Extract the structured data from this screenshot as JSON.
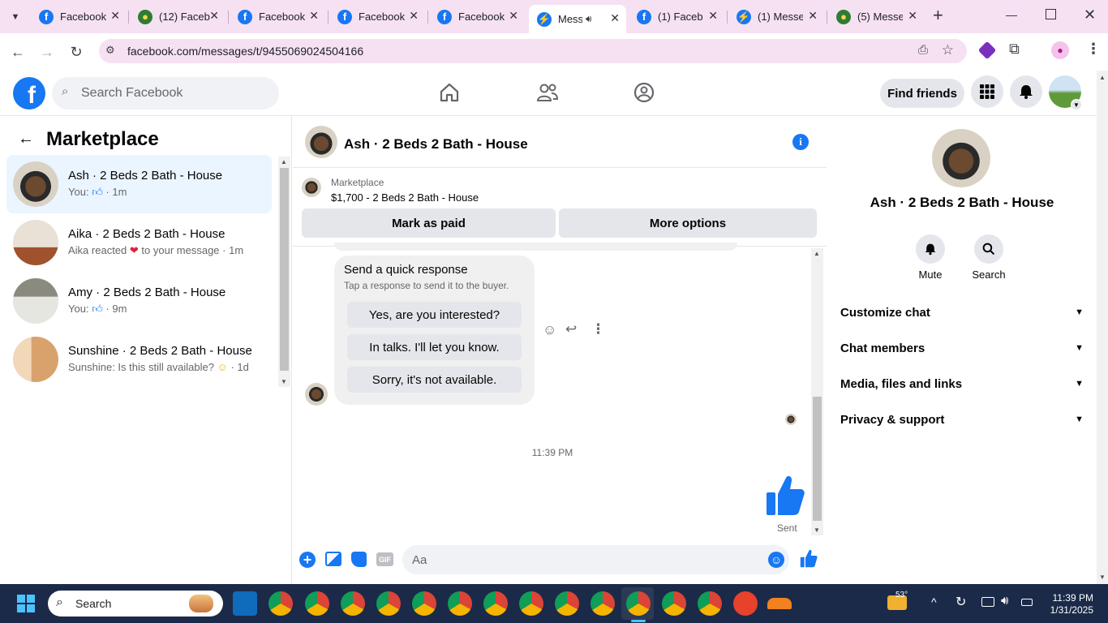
{
  "browser": {
    "tabs": [
      {
        "title": "Facebook",
        "icon": "facebook-icon"
      },
      {
        "title": "(12) Faceb",
        "icon": "globe-icon"
      },
      {
        "title": "Facebook",
        "icon": "facebook-icon"
      },
      {
        "title": "Facebook",
        "icon": "facebook-icon"
      },
      {
        "title": "Facebook",
        "icon": "facebook-icon"
      },
      {
        "title": "Messe",
        "icon": "messenger-icon",
        "active": true,
        "audio": true
      },
      {
        "title": "(1) Facebo",
        "icon": "facebook-icon"
      },
      {
        "title": "(1) Messe",
        "icon": "messenger-icon"
      },
      {
        "title": "(5) Messe",
        "icon": "globe-icon"
      }
    ],
    "new_tab_label": "+",
    "url": "facebook.com/messages/t/9455069024504166",
    "tab_bg_color": "#f6e1f3"
  },
  "facebook": {
    "logo_letter": "f",
    "search_placeholder": "Search Facebook",
    "find_friends_label": "Find friends",
    "brand_color": "#1877f2"
  },
  "left": {
    "title": "Marketplace",
    "conversations": [
      {
        "name": "Ash · 2 Beds 2 Bath - House",
        "prefix": "You:",
        "icon": "thumbs-up-icon",
        "time": "· 1m"
      },
      {
        "name": "Aika · 2 Beds 2 Bath - House",
        "prefix": "Aika reacted",
        "icon": "heart-icon",
        "suffix": "to your message",
        "time": "· 1m"
      },
      {
        "name": "Amy · 2 Beds 2 Bath - House",
        "prefix": "You:",
        "icon": "thumbs-up-icon",
        "time": "· 9m"
      },
      {
        "name": "Sunshine · 2 Beds 2 Bath - House",
        "prefix": "Sunshine: Is this still available?",
        "icon": "smile-emoji-icon",
        "time": "· 1d"
      }
    ]
  },
  "chat": {
    "header_name": "Ash · 2 Beds 2 Bath - House",
    "listing_source": "Marketplace",
    "listing": "$1,700 - 2 Beds 2 Bath - House",
    "mark_paid_label": "Mark as paid",
    "more_options_label": "More options",
    "quick_response_title": "Send a quick response",
    "quick_response_subtitle": "Tap a response to send it to the buyer.",
    "quick_responses": [
      "Yes, are you interested?",
      "In talks. I'll let you know.",
      "Sorry, it's not available."
    ],
    "timestamp": "11:39 PM",
    "sent_label": "Sent",
    "input_placeholder": "Aa"
  },
  "right": {
    "name": "Ash · 2 Beds 2 Bath - House",
    "mute_label": "Mute",
    "search_label": "Search",
    "sections": [
      "Customize chat",
      "Chat members",
      "Media, files and links",
      "Privacy & support"
    ]
  },
  "taskbar": {
    "search_placeholder": "Search",
    "temperature": "53°",
    "time": "11:39 PM",
    "date": "1/31/2025"
  }
}
